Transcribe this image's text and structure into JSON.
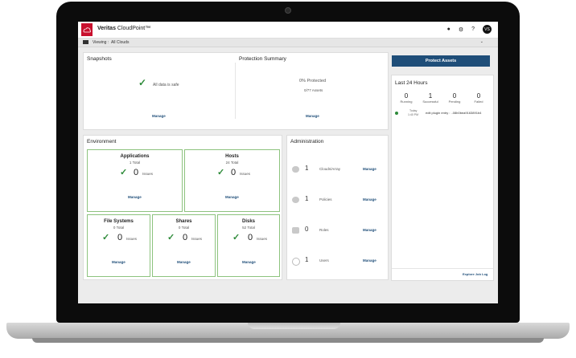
{
  "app": {
    "brand_bold": "Veritas",
    "brand_rest": " CloudPoint™",
    "avatar": "VS"
  },
  "icons": {
    "logo": "cloud-icon",
    "bell": "bell-icon",
    "gear": "gear-icon",
    "help": "help-icon",
    "chev": "chevron-down-icon"
  },
  "viewbar": {
    "label": "Viewing :",
    "value": "All Clouds"
  },
  "snapshots": {
    "title": "Snapshots",
    "status": "All data is safe",
    "manage": "Manage"
  },
  "protection": {
    "title": "Protection Summary",
    "percent": "0% Protected",
    "assets": "0/77 Assets",
    "manage": "Manage"
  },
  "environment": {
    "title": "Environment",
    "issues_label": "Issues",
    "manage": "Manage",
    "applications": {
      "title": "Applications",
      "total": "1 Total",
      "issues": "0"
    },
    "hosts": {
      "title": "Hosts",
      "total": "24 Total",
      "issues": "0"
    },
    "filesystems": {
      "title": "File Systems",
      "total": "0 Total",
      "issues": "0"
    },
    "shares": {
      "title": "Shares",
      "total": "0 Total",
      "issues": "0"
    },
    "disks": {
      "title": "Disks",
      "total": "52 Total",
      "issues": "0"
    }
  },
  "administration": {
    "title": "Administration",
    "manage": "Manage",
    "rows": [
      {
        "num": "1",
        "label": "Clouds/Array"
      },
      {
        "num": "1",
        "label": "Policies"
      },
      {
        "num": "0",
        "label": "Roles"
      },
      {
        "num": "1",
        "label": "Users"
      }
    ]
  },
  "right": {
    "protect_button": "Protect Assets",
    "last24_title": "Last 24 Hours",
    "stats": [
      {
        "n": "0",
        "l": "Running"
      },
      {
        "n": "1",
        "l": "Successful"
      },
      {
        "n": "0",
        "l": "Pending"
      },
      {
        "n": "0",
        "l": "Failed"
      }
    ],
    "job": {
      "day": "Today",
      "time": "1:40 PM",
      "text": "edit plugin entry : ..08b0bea9163891b4"
    },
    "explore": "Explore Job Log"
  }
}
